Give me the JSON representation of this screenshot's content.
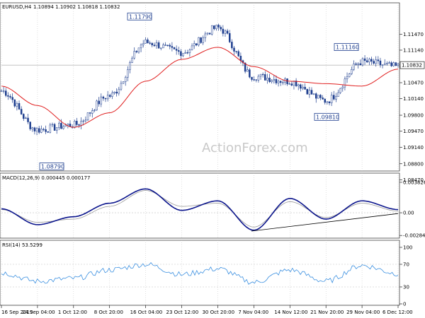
{
  "main": {
    "title": "EURUSD,H4",
    "ohlc": "1.10894 1.10902 1.10818 1.10832",
    "ylim": [
      1.0868,
      1.1194
    ],
    "ticks": [
      "1.11470",
      "1.11140",
      "1.10800",
      "1.10470",
      "1.10140",
      "1.09800",
      "1.09470",
      "1.09140",
      "1.08800",
      "1.08470"
    ],
    "current_price": "1.10832",
    "annotations": [
      {
        "label": "1.11790",
        "value": 1.1179
      },
      {
        "label": "1.08790",
        "value": 1.0879
      },
      {
        "label": "1.11160",
        "value": 1.1116
      },
      {
        "label": "1.09810",
        "value": 1.0981
      }
    ],
    "watermark": "ActionForex.com"
  },
  "macd": {
    "title": "MACD(12,26,9) 0.000445 0.000177",
    "ticks": [
      "0.003826",
      "0.00",
      "-0.002849"
    ],
    "ylim": [
      -0.0031,
      0.004
    ]
  },
  "rsi": {
    "title": "RSI(14) 53.5299",
    "ticks": [
      "100",
      "70",
      "30",
      "0"
    ],
    "ylim": [
      0,
      100
    ]
  },
  "x_labels": [
    "16 Sep 2019",
    "24 Sep 04:00",
    "1 Oct 12:00",
    "8 Oct 20:00",
    "16 Oct 04:00",
    "23 Oct 12:00",
    "30 Oct 20:00",
    "7 Nov 04:00",
    "14 Nov 12:00",
    "21 Nov 20:00",
    "29 Nov 04:00",
    "6 Dec 12:00"
  ],
  "colors": {
    "candle": "#1f3f8f",
    "ma": "#e02020",
    "macd": "#0a148c",
    "signal": "#999999",
    "rsi": "#3a8fe0",
    "trend": "#000000",
    "grid": "#c0c0c0"
  },
  "chart_data": [
    {
      "type": "line",
      "name": "EURUSD,H4",
      "x": [
        "16 Sep 2019",
        "24 Sep 04:00",
        "1 Oct 12:00",
        "8 Oct 20:00",
        "16 Oct 04:00",
        "23 Oct 12:00",
        "30 Oct 20:00",
        "7 Nov 04:00",
        "14 Nov 12:00",
        "21 Nov 20:00",
        "29 Nov 04:00",
        "6 Dec 12:00"
      ],
      "series": [
        {
          "values": [
            1.103,
            1.095,
            1.096,
            1.102,
            1.113,
            1.111,
            1.116,
            1.106,
            1.105,
            1.101,
            1.109,
            1.108
          ]
        },
        {
          "values": [
            1.104,
            1.1,
            1.0955,
            1.0985,
            1.105,
            1.1095,
            1.112,
            1.108,
            1.105,
            1.1045,
            1.104,
            1.1075
          ]
        }
      ]
    },
    {
      "type": "line",
      "name": "MACD(12,26,9)",
      "x": [
        "16 Sep 2019",
        "24 Sep 04:00",
        "1 Oct 12:00",
        "8 Oct 20:00",
        "16 Oct 04:00",
        "23 Oct 12:00",
        "30 Oct 20:00",
        "7 Nov 04:00",
        "14 Nov 12:00",
        "21 Nov 20:00",
        "29 Nov 04:00",
        "6 Dec 12:00"
      ],
      "series": [
        {
          "values": [
            0.0005,
            -0.0015,
            -0.0005,
            0.0012,
            0.003,
            0.0003,
            0.0015,
            -0.0022,
            0.0018,
            -0.0008,
            0.0015,
            0.0004
          ]
        },
        {
          "values": [
            0.0004,
            -0.0012,
            -0.0008,
            0.0008,
            0.0028,
            0.0008,
            0.0012,
            -0.0018,
            0.0014,
            -0.0006,
            0.0012,
            0.0002
          ]
        }
      ]
    },
    {
      "type": "line",
      "name": "RSI(14)",
      "x": [
        "16 Sep 2019",
        "24 Sep 04:00",
        "1 Oct 12:00",
        "8 Oct 20:00",
        "16 Oct 04:00",
        "23 Oct 12:00",
        "30 Oct 20:00",
        "7 Nov 04:00",
        "14 Nov 12:00",
        "21 Nov 20:00",
        "29 Nov 04:00",
        "6 Dec 12:00"
      ],
      "ylim": [
        0,
        100
      ],
      "series": [
        {
          "values": [
            55,
            40,
            45,
            60,
            70,
            52,
            62,
            38,
            60,
            40,
            68,
            53.5299
          ]
        }
      ]
    }
  ]
}
